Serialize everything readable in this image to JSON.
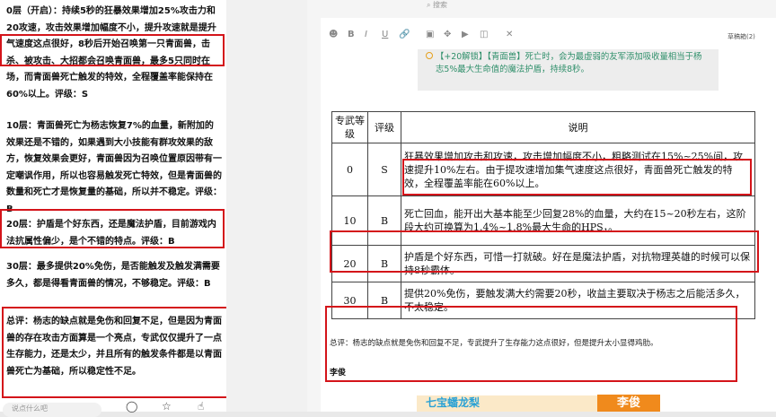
{
  "left": {
    "paragraphs": [
      "0层（开启）：持续5秒的狂暴效果增加25%攻击力和20攻速，攻击效果增加幅度不小，提升攻速就是提升气速度这点很好，8秒后开始召唤第一只青面兽，击杀、被攻击、大招都会召唤青面兽，最多5只同时在场，而青面兽死亡触发的特效，全程覆盖率能保持在60%以上。评级：S",
      "10层：青面兽死亡为杨志恢复7%的血量，新附加的效果还是不错的，如果遇到大小技能有群攻效果的敌方，恢复效果会更好，青面兽因为召唤位置原因带有一定嘲讽作用，所以也容易触发死亡特效，但是青面兽的数量和死亡才是恢复量的基础，所以并不稳定。评级：B",
      "20层：护盾是个好东西，还是魔法护盾，目前游戏内法抗属性偏少，是个不错的特点。评级：B",
      "30层：最多提供20%免伤，是否能触发及触发满需要多久，都是得看青面兽的情况，不够稳定。评级：B",
      "总评：杨志的缺点就是免伤和回复不足，但是因为青面兽的存在攻击方面算是一个亮点，专武仅仅提升了一点生存能力，还是太少，并且所有的触发条件都是以青面兽死亡为基础，所以稳定性不足。"
    ],
    "search_placeholder": "说点什么吧"
  },
  "editor": {
    "top_search": "搜索",
    "draft_label": "草稿箱(2)",
    "quote": "【+20解锁】【青面兽】死亡时，会为最虚弱的友军添加吸收量相当于杨志5%最大生命值的魔法护盾，持续8秒。"
  },
  "table": {
    "headers": [
      "专武等级",
      "评级",
      "说明"
    ],
    "rows": [
      {
        "level": "0",
        "grade": "S",
        "desc": "狂暴效果增加攻击和攻速，攻击增加幅度不小，粗略测试在15%~25%间，攻速提升10%左右。由于提攻速增加集气速度这点很好，青面兽死亡触发的特效，全程覆盖率能在60%以上。"
      },
      {
        "level": "10",
        "grade": "B",
        "desc": "死亡回血，能开出大基本能至少回复28%的血量，大约在15~20秒左右，这阶段大约可换算为1.4%~1.8%最大生命的HPS，。"
      },
      {
        "level": "20",
        "grade": "B",
        "desc": "护盾是个好东西，可惜一打就破。好在是魔法护盾，对抗物理英雄的时候可以保持8秒霸体。"
      },
      {
        "level": "30",
        "grade": "B",
        "desc": "提供20%免伤，要触发满大约需要20秒，收益主要取决于杨志之后能活多久，不太稳定。"
      }
    ]
  },
  "summary": "总评：杨志的缺点就是免伤和回复不足，专武提升了生存能力这点很好，但是提升太小显得鸡肋。",
  "author": "李俊",
  "banner": {
    "left_text": "七宝蟠龙梨",
    "right_text": "李俊"
  }
}
